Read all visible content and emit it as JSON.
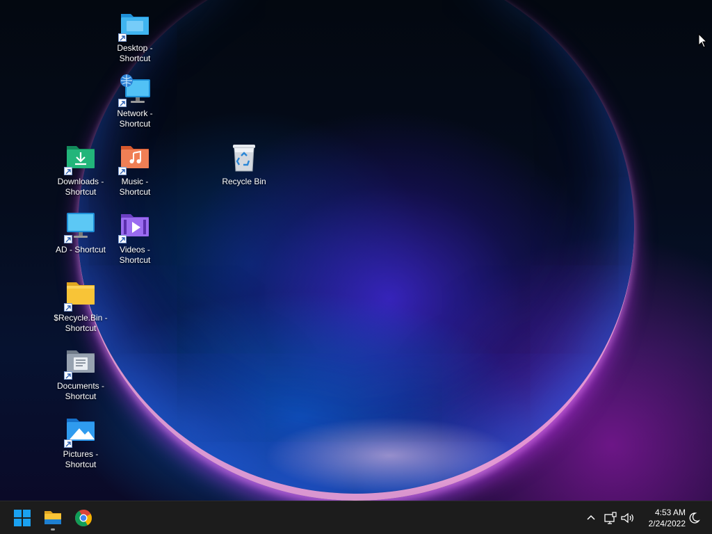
{
  "desktop": {
    "icons": [
      {
        "label": "Desktop -\nShortcut",
        "icon": "desktop-folder-icon"
      },
      {
        "label": "Network -\nShortcut",
        "icon": "network-icon"
      },
      {
        "label": "Downloads -\nShortcut",
        "icon": "downloads-folder-icon"
      },
      {
        "label": "Music -\nShortcut",
        "icon": "music-folder-icon"
      },
      {
        "label": "Recycle Bin",
        "icon": "recycle-bin-icon"
      },
      {
        "label": "AD - Shortcut",
        "icon": "monitor-icon"
      },
      {
        "label": "Videos -\nShortcut",
        "icon": "videos-folder-icon"
      },
      {
        "label": "$Recycle.Bin -\nShortcut",
        "icon": "folder-icon"
      },
      {
        "label": "Documents -\nShortcut",
        "icon": "documents-folder-icon"
      },
      {
        "label": "Pictures -\nShortcut",
        "icon": "pictures-folder-icon"
      }
    ]
  },
  "taskbar": {
    "pinned": [
      {
        "name": "Start",
        "icon": "windows-start-icon"
      },
      {
        "name": "File Explorer",
        "icon": "file-explorer-icon"
      },
      {
        "name": "Google Chrome",
        "icon": "chrome-icon"
      }
    ],
    "tray": {
      "icons": [
        "chevron-up-icon",
        "network-icon",
        "volume-icon",
        "focus-assist-icon"
      ]
    },
    "clock": {
      "time": "4:53 AM",
      "date": "2/24/2022"
    }
  },
  "colors": {
    "taskbar_bg": "#1c1c1c",
    "start_blue": "#1aa1f1",
    "folder_yellow": "#f8c437"
  }
}
